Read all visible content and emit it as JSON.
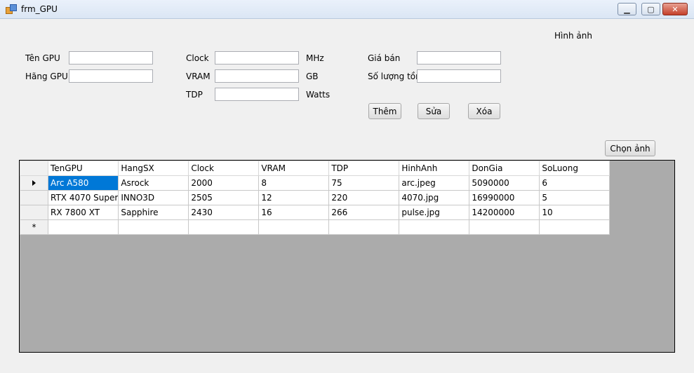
{
  "window": {
    "title": "frm_GPU",
    "minimize": "▁",
    "maximize": "▢",
    "close": "✕"
  },
  "form": {
    "ten_gpu_label": "Tên GPU",
    "hang_gpu_label": "Hãng GPU",
    "clock_label": "Clock",
    "clock_unit": "MHz",
    "vram_label": "VRAM",
    "vram_unit": "GB",
    "tdp_label": "TDP",
    "tdp_unit": "Watts",
    "gia_ban_label": "Giá bán",
    "so_luong_label": "Số lượng tồn",
    "hinh_anh_label": "Hình ảnh",
    "values": {
      "ten_gpu": "",
      "hang_gpu": "",
      "clock": "",
      "vram": "",
      "tdp": "",
      "gia_ban": "",
      "so_luong": ""
    }
  },
  "buttons": {
    "them": "Thêm",
    "sua": "Sửa",
    "xoa": "Xóa",
    "chon_anh": "Chọn ảnh"
  },
  "grid": {
    "columns": [
      "TenGPU",
      "HangSX",
      "Clock",
      "VRAM",
      "TDP",
      "HinhAnh",
      "DonGia",
      "SoLuong"
    ],
    "rows": [
      [
        "Arc A580",
        "Asrock",
        "2000",
        "8",
        "75",
        "arc.jpeg",
        "5090000",
        "6"
      ],
      [
        "RTX 4070 Super",
        "INNO3D",
        "2505",
        "12",
        "220",
        "4070.jpg",
        "16990000",
        "5"
      ],
      [
        "RX 7800 XT",
        "Sapphire",
        "2430",
        "16",
        "266",
        "pulse.jpg",
        "14200000",
        "10"
      ]
    ],
    "new_row_marker": "*"
  }
}
